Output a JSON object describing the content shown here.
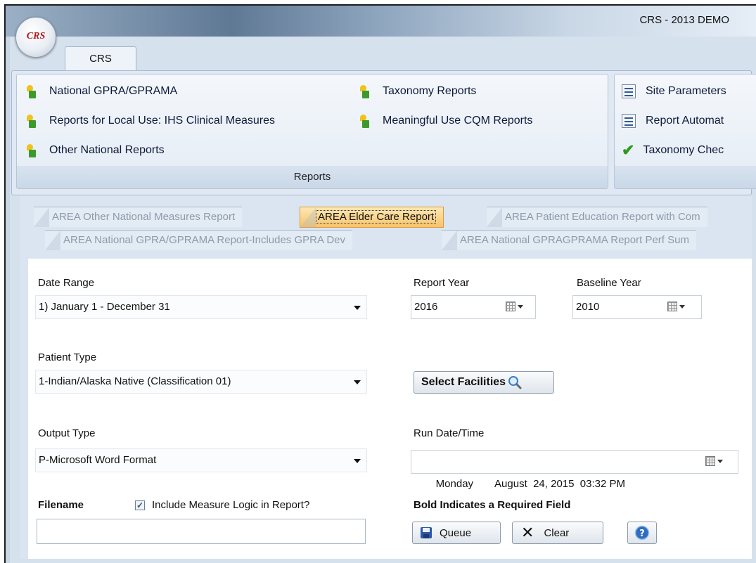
{
  "app": {
    "orb_label": "CRS",
    "title": "CRS - 2013 DEMO"
  },
  "ribbon": {
    "tab_label": "CRS",
    "group_reports": {
      "label": "Reports",
      "items": [
        {
          "label": "National GPRA/GPRAMA",
          "icon": "plant-report-icon"
        },
        {
          "label": "Reports for Local Use: IHS Clinical Measures",
          "icon": "plant-report-icon"
        },
        {
          "label": "Other National Reports",
          "icon": "plant-report-icon"
        },
        {
          "label": "Taxonomy Reports",
          "icon": "plant-report-icon"
        },
        {
          "label": "Meaningful Use CQM Reports",
          "icon": "plant-report-icon"
        }
      ]
    },
    "group_right": {
      "items": [
        {
          "label": "Site Parameters",
          "icon": "list-settings-icon"
        },
        {
          "label": "Report Automat",
          "icon": "list-settings-icon"
        },
        {
          "label": "Taxonomy Chec",
          "icon": "green-check-icon"
        }
      ]
    }
  },
  "doc_tabs": {
    "row1": [
      "AREA Other National Measures Report",
      "AREA Elder Care Report",
      "AREA Patient Education Report with Com"
    ],
    "row2": [
      "AREA National GPRA/GPRAMA Report-Includes GPRA Dev",
      "AREA National GPRAGPRAMA Report Perf Sum"
    ],
    "active": "AREA Elder Care Report"
  },
  "form": {
    "date_range": {
      "label": "Date Range",
      "value": "1) January 1 - December 31"
    },
    "report_year": {
      "label": "Report Year",
      "value": "2016"
    },
    "baseline_year": {
      "label": "Baseline Year",
      "value": "2010"
    },
    "patient_type": {
      "label": "Patient Type",
      "value": "1-Indian/Alaska Native (Classification 01)"
    },
    "select_facilities_label": "Select Facilities",
    "output_type": {
      "label": "Output Type",
      "value": "P-Microsoft Word Format"
    },
    "run_datetime": {
      "label": "Run Date/Time",
      "day": "Monday",
      "date": "August  24, 2015  03:32 PM"
    },
    "filename": {
      "label": "Filename",
      "value": ""
    },
    "include_logic": {
      "label": "Include Measure Logic in Report?",
      "checked": true
    },
    "required_note": "Bold Indicates a Required Field",
    "queue_label": "Queue",
    "clear_label": "Clear"
  }
}
